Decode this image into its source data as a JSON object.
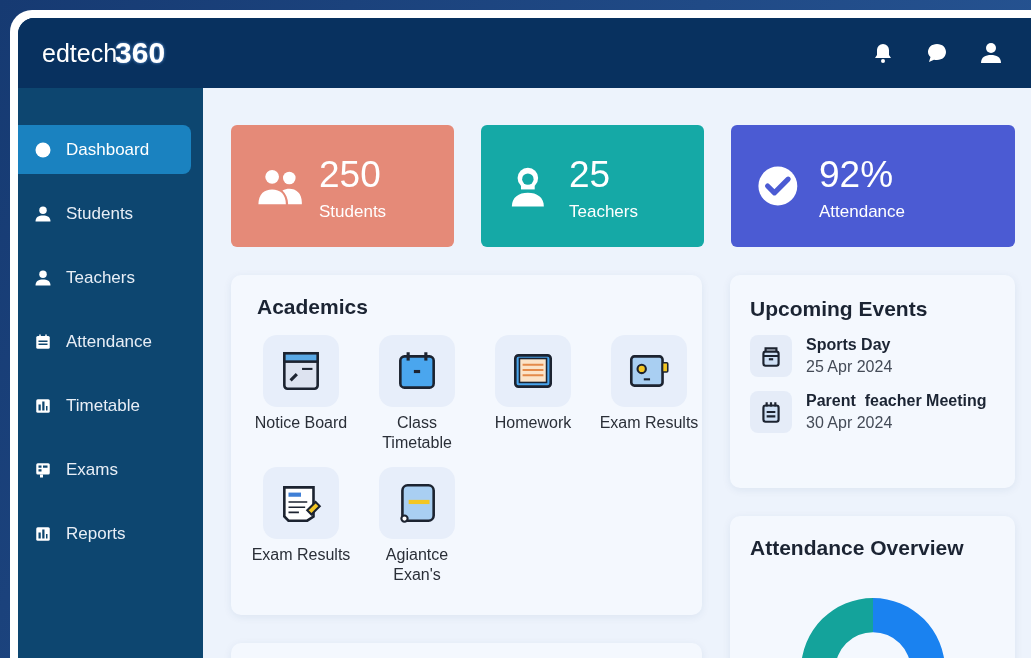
{
  "logo": {
    "text": "edtech",
    "number": "360"
  },
  "header_icons": [
    {
      "kind": "bell"
    },
    {
      "kind": "chat"
    },
    {
      "kind": "user"
    }
  ],
  "sidebar": {
    "items": [
      {
        "label": "Dashboard",
        "kind": "dot",
        "selected": true
      },
      {
        "label": "Students",
        "kind": "user",
        "selected": false
      },
      {
        "label": "Teachers",
        "kind": "user",
        "selected": false
      },
      {
        "label": "Attendance",
        "kind": "calendar",
        "selected": false
      },
      {
        "label": "Timetable",
        "kind": "chart",
        "selected": false
      },
      {
        "label": "Exams",
        "kind": "grid",
        "selected": false
      },
      {
        "label": "Reports",
        "kind": "chart",
        "selected": false
      }
    ]
  },
  "stats": [
    {
      "value": "250",
      "label": "Students",
      "kind": "group",
      "color": "#e58a78"
    },
    {
      "value": "25",
      "label": "Teachers",
      "kind": "teacher",
      "color": "#15a9a6"
    },
    {
      "value": "92%",
      "label": "Attendance",
      "kind": "check",
      "color": "#4b5bd3"
    }
  ],
  "academics": {
    "title": "Academics",
    "tiles": [
      {
        "label": "Notice Board",
        "kind": "board"
      },
      {
        "label": "Class Timetable",
        "kind": "calendar"
      },
      {
        "label": "Homework",
        "kind": "book"
      },
      {
        "label": "Exam Results",
        "kind": "screen"
      },
      {
        "label": "Exam Results",
        "kind": "document"
      },
      {
        "label": "Agiantce Exan's",
        "kind": "notebook"
      }
    ]
  },
  "events": {
    "title": "Upcoming Events",
    "items": [
      {
        "title": "Sports Day",
        "date": "25 Apr 2024",
        "kind": "box"
      },
      {
        "title": "Parent  feacher Meeting",
        "date": "30 Apr 2024",
        "kind": "calendar"
      }
    ]
  },
  "attendance_overview": {
    "title": "Attendance Overview"
  }
}
